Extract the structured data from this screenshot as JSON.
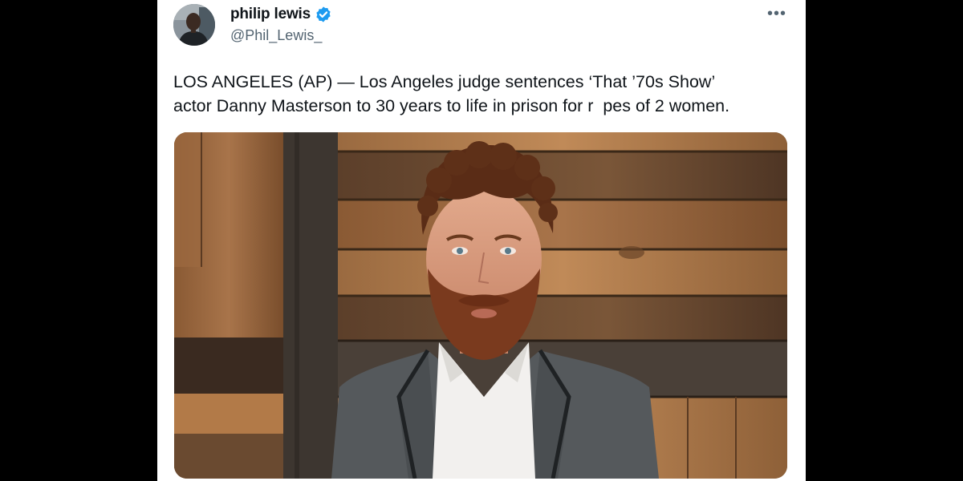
{
  "tweet": {
    "author": {
      "display_name": "philip lewis",
      "handle": "@Phil_Lewis_",
      "verified": true,
      "verified_icon": "verified-badge-icon",
      "verified_color": "#1d9bf0"
    },
    "more_label": "•••",
    "text_lines": [
      "LOS ANGELES (AP) — Los Angeles judge sentences ‘That ’70s Show’",
      "actor Danny Masterson to 30 years to life in prison for r  pes of 2 women."
    ],
    "media": {
      "type": "photo",
      "subject": "bearded man in grey blazer in front of a wooden plank wall"
    }
  },
  "colors": {
    "text_primary": "#0f1419",
    "text_secondary": "#536471",
    "background": "#ffffff",
    "letterbox": "#000000"
  }
}
